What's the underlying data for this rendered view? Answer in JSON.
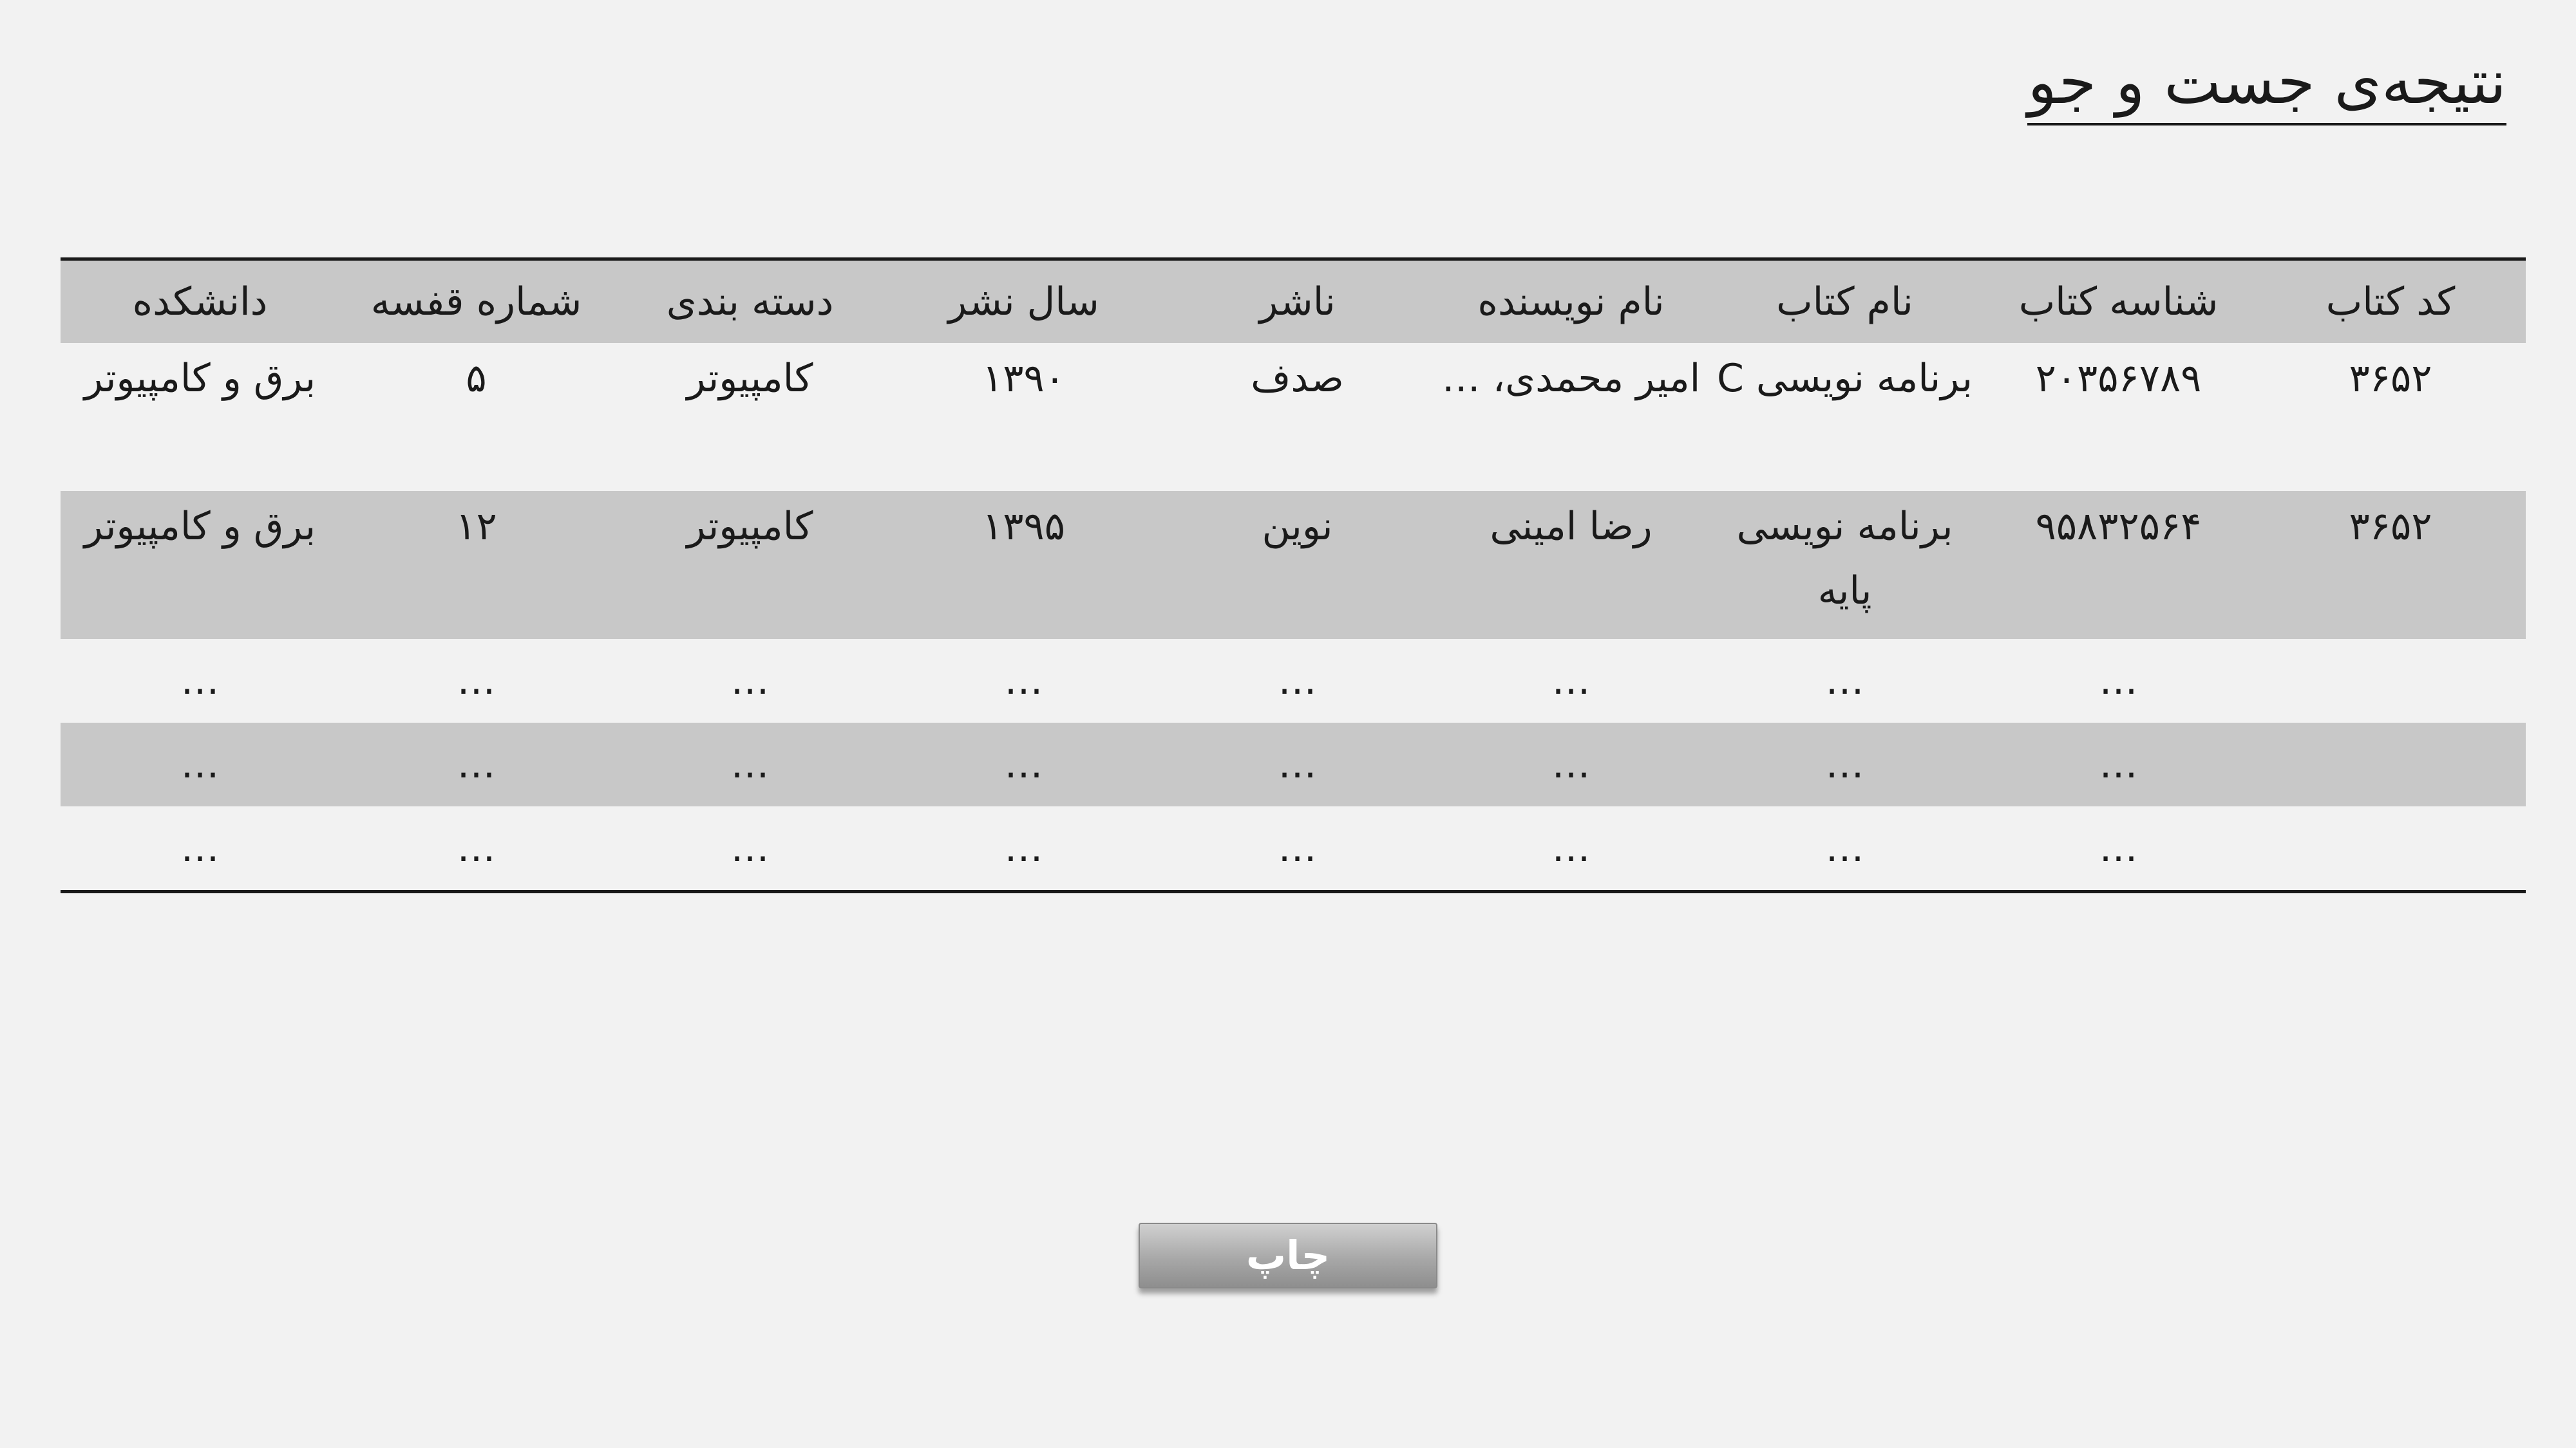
{
  "page": {
    "title": "نتیجه‌ی جست و جو"
  },
  "table": {
    "headers": [
      "کد کتاب",
      "شناسه کتاب",
      "نام کتاب",
      "نام نویسنده",
      "ناشر",
      "سال نشر",
      "دسته بندی",
      "شماره قفسه",
      "دانشکده"
    ],
    "rows": [
      [
        "۳۶۵۲",
        "۲۰۳۵۶۷۸۹",
        "برنامه نویسی C",
        "امیر محمدی، …",
        "صدف",
        "۱۳۹۰",
        "کامپیوتر",
        "۵",
        "برق و کامپیوتر"
      ],
      [
        "۳۶۵۲",
        "۹۵۸۳۲۵۶۴",
        "برنامه نویسی پایه",
        "رضا امینی",
        "نوین",
        "۱۳۹۵",
        "کامپیوتر",
        "۱۲",
        "برق و کامپیوتر"
      ],
      [
        "",
        "…",
        "…",
        "…",
        "…",
        "…",
        "…",
        "…",
        "…"
      ],
      [
        "",
        "…",
        "…",
        "…",
        "…",
        "…",
        "…",
        "…",
        "…"
      ],
      [
        "",
        "…",
        "…",
        "…",
        "…",
        "…",
        "…",
        "…",
        "…"
      ]
    ]
  },
  "actions": {
    "print_label": "چاپ"
  }
}
